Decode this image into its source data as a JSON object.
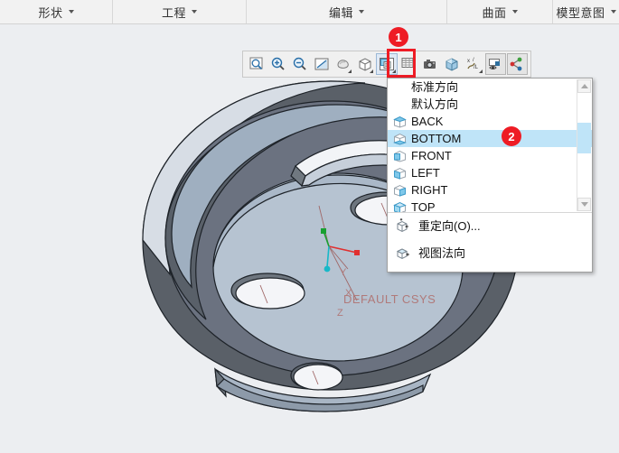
{
  "ribbon": {
    "tabs": [
      {
        "label": "形状",
        "name": "tab-shape"
      },
      {
        "label": "工程",
        "name": "tab-engineering"
      },
      {
        "label": "编辑",
        "name": "tab-edit"
      },
      {
        "label": "曲面",
        "name": "tab-surface"
      },
      {
        "label": "模型意图",
        "name": "tab-model-intent"
      }
    ]
  },
  "toolbar": {
    "buttons": [
      {
        "icon": "zoom-to-fit-icon",
        "title": "重新调整"
      },
      {
        "icon": "zoom-in-icon",
        "title": "放大"
      },
      {
        "icon": "zoom-out-icon",
        "title": "缩小"
      },
      {
        "icon": "repaint-icon",
        "title": "重画"
      },
      {
        "icon": "display-style-icon",
        "title": "显示样式"
      },
      {
        "icon": "perspective-view-icon",
        "title": "透视图"
      },
      {
        "icon": "view-manager-icon",
        "title": "已保存方向"
      },
      {
        "icon": "view-list-icon",
        "title": "视图管理器"
      },
      {
        "icon": "camera-icon",
        "title": "图像捕获"
      },
      {
        "icon": "appearance-cube-icon",
        "title": "外观"
      },
      {
        "icon": "annotation-display-icon",
        "title": "注释显示"
      },
      {
        "icon": "layer-visibility-icon",
        "title": "层可见性"
      },
      {
        "icon": "relation-icon",
        "title": "关系"
      }
    ],
    "active_index": 6
  },
  "menu": {
    "items": [
      {
        "label": "标准方向",
        "icon": "none",
        "type": "text"
      },
      {
        "label": "默认方向",
        "icon": "none",
        "type": "text"
      },
      {
        "label": "BACK",
        "icon": "cube-back-icon",
        "type": "view"
      },
      {
        "label": "BOTTOM",
        "icon": "cube-bottom-icon",
        "type": "view",
        "selected": true
      },
      {
        "label": "FRONT",
        "icon": "cube-front-icon",
        "type": "view"
      },
      {
        "label": "LEFT",
        "icon": "cube-left-icon",
        "type": "view"
      },
      {
        "label": "RIGHT",
        "icon": "cube-right-icon",
        "type": "view"
      },
      {
        "label": "TOP",
        "icon": "cube-top-icon",
        "type": "view"
      }
    ],
    "bottom_items": [
      {
        "label": "重定向(O)...",
        "icon": "reorient-icon"
      },
      {
        "label": "视图法向",
        "icon": "view-normal-icon"
      }
    ]
  },
  "annotations": {
    "markers": [
      {
        "text": "1",
        "target": "view-manager-toolbar-button"
      },
      {
        "text": "2",
        "target": "menu-item-bottom"
      }
    ],
    "highlight_color": "#ee1c25"
  },
  "viewport": {
    "csys_label": "DEFAULT CSYS",
    "axis_x": "X",
    "axis_y": "Y",
    "axis_z": "Z",
    "background_color": "#eceef1",
    "model_dark_color": "#5a6068",
    "model_light_color": "#aab7c6",
    "model_face_color": "#b6c2d0"
  }
}
